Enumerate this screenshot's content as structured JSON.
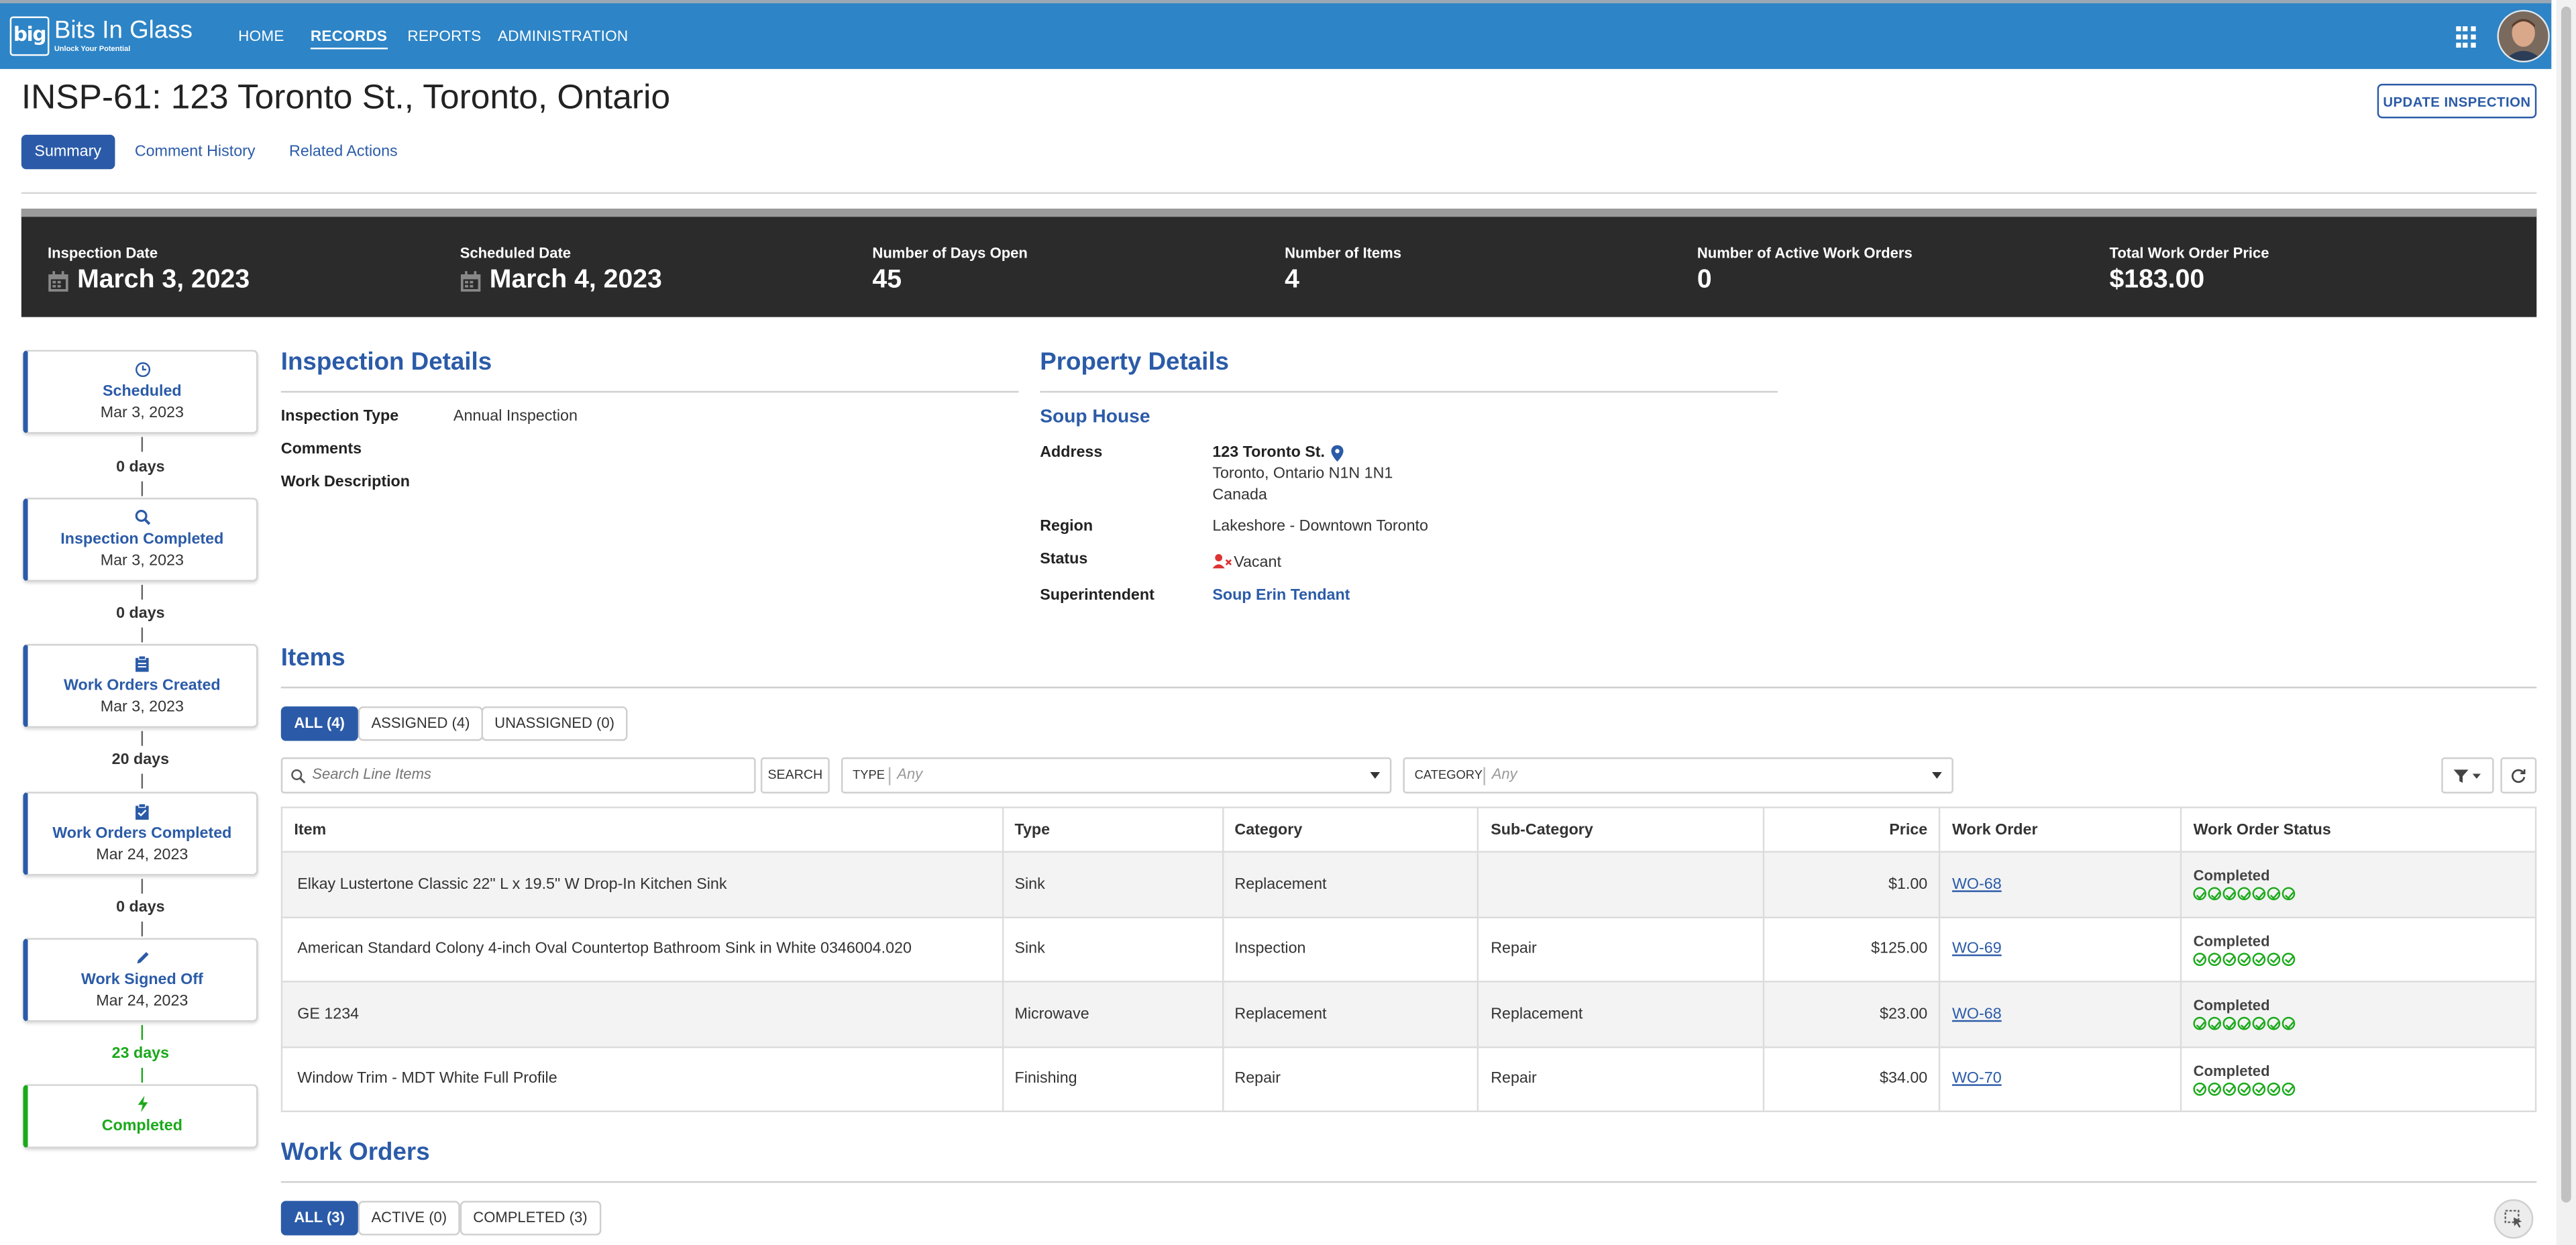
{
  "brand": {
    "name": "Bits In Glass",
    "tagline": "Unlock Your Potential",
    "logo_text": "big"
  },
  "nav": [
    "HOME",
    "RECORDS",
    "REPORTS",
    "ADMINISTRATION"
  ],
  "page": {
    "title": "INSP-61: 123 Toronto St., Toronto, Ontario",
    "update_button": "UPDATE INSPECTION"
  },
  "tabs": [
    "Summary",
    "Comment History",
    "Related Actions"
  ],
  "kpis": [
    {
      "label": "Inspection Date",
      "value": "March 3, 2023"
    },
    {
      "label": "Scheduled Date",
      "value": "March 4, 2023"
    },
    {
      "label": "Number of Days Open",
      "value": "45"
    },
    {
      "label": "Number of Items",
      "value": "4"
    },
    {
      "label": "Number of Active Work Orders",
      "value": "0"
    },
    {
      "label": "Total Work Order Price",
      "value": "$183.00"
    }
  ],
  "timeline": [
    {
      "title": "Scheduled",
      "date": "Mar 3, 2023",
      "icon": "clock-icon"
    },
    {
      "title": "Inspection Completed",
      "date": "Mar 3, 2023",
      "icon": "magnify-icon"
    },
    {
      "title": "Work Orders Created",
      "date": "Mar 3, 2023",
      "icon": "clipboard-icon"
    },
    {
      "title": "Work Orders Completed",
      "date": "Mar 24, 2023",
      "icon": "clipboard-check-icon"
    },
    {
      "title": "Work Signed Off",
      "date": "Mar 24, 2023",
      "icon": "pen-icon"
    },
    {
      "title": "Completed",
      "date": "",
      "icon": "bolt-icon"
    }
  ],
  "timeline_gaps": [
    "0 days",
    "0 days",
    "20 days",
    "0 days",
    "23 days"
  ],
  "inspection_details": {
    "title": "Inspection Details",
    "type_label": "Inspection Type",
    "type_value": "Annual Inspection",
    "comments_label": "Comments",
    "work_label": "Work Description"
  },
  "property_details": {
    "title": "Property Details",
    "name": "Soup House",
    "address_label": "Address",
    "address_line1": "123 Toronto St.",
    "address_line2": "Toronto, Ontario N1N 1N1",
    "address_line3": "Canada",
    "region_label": "Region",
    "region_value": "Lakeshore - Downtown Toronto",
    "status_label": "Status",
    "status_value": "Vacant",
    "super_label": "Superintendent",
    "super_value": "Soup Erin Tendant"
  },
  "items": {
    "title": "Items",
    "filters": [
      "ALL (4)",
      "ASSIGNED (4)",
      "UNASSIGNED (0)"
    ],
    "search_placeholder": "Search Line Items",
    "search_button": "SEARCH",
    "type_label": "TYPE",
    "type_value": "Any",
    "category_label": "CATEGORY",
    "category_value": "Any",
    "columns": [
      "Item",
      "Type",
      "Category",
      "Sub-Category",
      "Price",
      "Work Order",
      "Work Order Status"
    ],
    "rows": [
      {
        "item": "Elkay Lustertone Classic 22\" L x 19.5\" W Drop-In Kitchen Sink",
        "type": "Sink",
        "category": "Replacement",
        "subcategory": "",
        "price": "$1.00",
        "wo": "WO-68",
        "status": "Completed"
      },
      {
        "item": "American Standard Colony 4-inch Oval Countertop Bathroom Sink in White 0346004.020",
        "type": "Sink",
        "category": "Inspection",
        "subcategory": "Repair",
        "price": "$125.00",
        "wo": "WO-69",
        "status": "Completed"
      },
      {
        "item": "GE 1234",
        "type": "Microwave",
        "category": "Replacement",
        "subcategory": "Replacement",
        "price": "$23.00",
        "wo": "WO-68",
        "status": "Completed"
      },
      {
        "item": "Window Trim - MDT White Full Profile",
        "type": "Finishing",
        "category": "Repair",
        "subcategory": "Repair",
        "price": "$34.00",
        "wo": "WO-70",
        "status": "Completed"
      }
    ]
  },
  "work_orders": {
    "title": "Work Orders",
    "filters": [
      "ALL (3)",
      "ACTIVE (0)",
      "COMPLETED (3)"
    ]
  },
  "colors": {
    "accent": "#2b5ba8",
    "topbar": "#2d84c6",
    "success": "#1aa91a",
    "kpi_bg": "#2b2b2b"
  }
}
